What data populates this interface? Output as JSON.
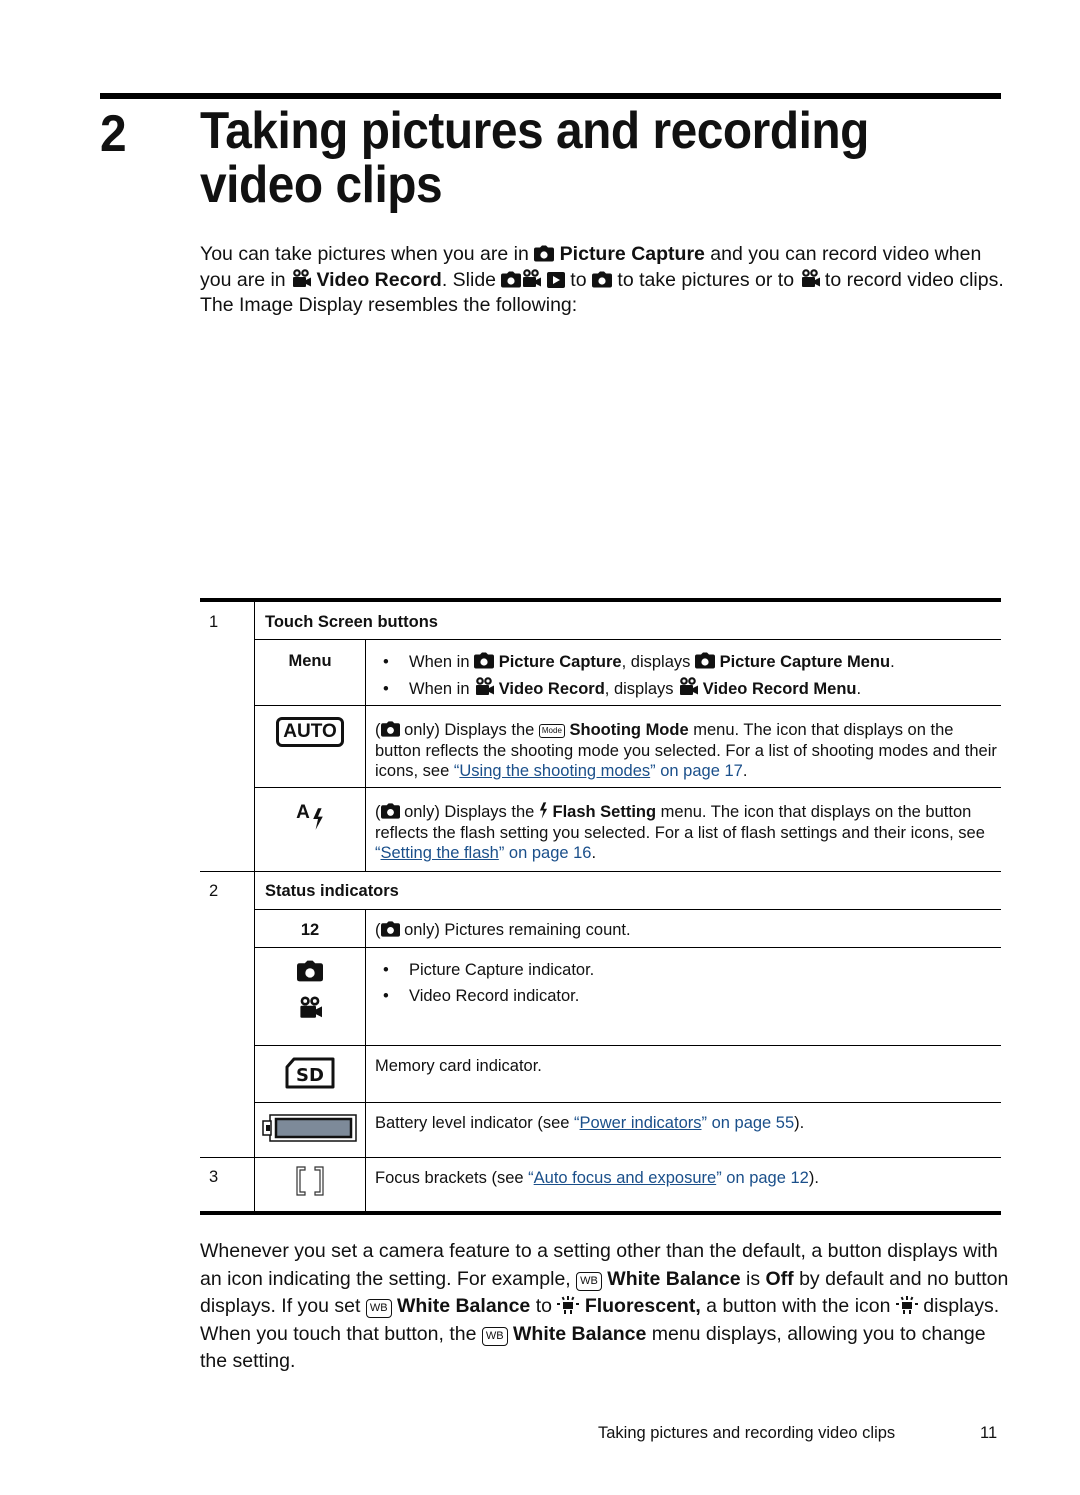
{
  "chapter": {
    "number": "2",
    "title": "Taking pictures and recording video clips"
  },
  "intro": {
    "t1": "You can take pictures when you are in ",
    "picture_capture": "Picture Capture",
    "t2": " and you can record video when you are in ",
    "video_record": "Video Record",
    "t3": ". Slide ",
    "t4": " to ",
    "t5": " to take pictures or to ",
    "t6": " to record video clips. The Image Display resembles the following:"
  },
  "table": {
    "sections": [
      {
        "number": "1",
        "heading": "Touch Screen buttons",
        "rows": [
          {
            "label": "Menu",
            "bullets": [
              {
                "pre": "When in ",
                "mode": "Picture Capture",
                "mid": ", displays ",
                "menu": "Picture Capture Menu",
                "post": "."
              },
              {
                "pre": "When in ",
                "mode": "Video Record",
                "mid": ", displays ",
                "menu": "Video Record Menu",
                "post": "."
              }
            ]
          },
          {
            "icon": "auto-mode-icon",
            "icon_text": "AUTO",
            "t1": "(",
            "t2": " only) Displays the ",
            "mode_badge": "Mode",
            "bold": "Shooting Mode",
            "t3": " menu. The icon that displays on the button reflects the shooting mode you selected. For a list of shooting modes and their icons, see ",
            "link_open": "“",
            "link": "Using the shooting modes",
            "link_close": "” on page 17",
            "t4": "."
          },
          {
            "icon": "auto-flash-icon",
            "icon_text": "A",
            "t1": "(",
            "t2": " only) Displays the ",
            "bold": "Flash Setting",
            "t3": " menu. The icon that displays on the button reflects the flash setting you selected. For a list of flash settings and their icons, see ",
            "link_open": "“",
            "link": "Setting the flash",
            "link_close": "” on page 16",
            "t4": "."
          }
        ]
      },
      {
        "number": "2",
        "heading": "Status indicators",
        "rows": [
          {
            "label": "12",
            "t1": "(",
            "t2": " only) Pictures remaining count."
          },
          {
            "bullets": [
              "Picture Capture indicator.",
              "Video Record indicator."
            ]
          },
          {
            "icon_text": "SD",
            "text": "Memory card indicator."
          },
          {
            "pre": "Battery level indicator (see ",
            "link_open": "“",
            "link": "Power indicators",
            "link_close": "” on page 55",
            "post": ")."
          }
        ]
      },
      {
        "number": "3",
        "rows": [
          {
            "pre": "Focus brackets (see ",
            "link_open": "“",
            "link": "Auto focus and exposure",
            "link_close": "” on page 12",
            "post": ")."
          }
        ]
      }
    ],
    "bullet_char": "•"
  },
  "outro": {
    "t1": "Whenever you set a camera feature to a setting other than the default, a button displays with an icon indicating the setting. For example, ",
    "wb": "White Balance",
    "t2": " is ",
    "off": "Off",
    "t3": " by default and no button displays. If you set ",
    "t4": " to ",
    "fluorescent": "Fluorescent,",
    "t5": " a button with the icon ",
    "t6": " displays. When you touch that button, the ",
    "t7": " menu displays, allowing you to change the setting.",
    "wb_badge": "WB"
  },
  "footer": {
    "title": "Taking pictures and recording video clips",
    "page": "11"
  },
  "colors": {
    "link": "#1a4f8a",
    "battery_fill": "#7d8a99"
  }
}
